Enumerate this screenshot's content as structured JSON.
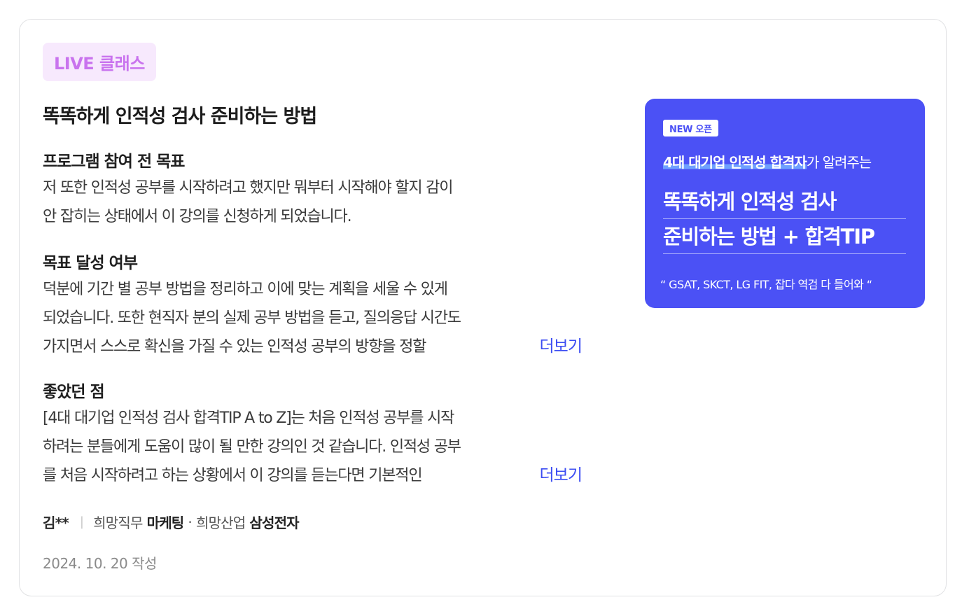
{
  "badge": "LIVE 클래스",
  "title": "똑똑하게 인적성 검사 준비하는 방법",
  "sections": [
    {
      "heading": "프로그램 참여 전 목표",
      "lines": [
        "저 또한 인적성 공부를 시작하려고 했지만 뭐부터 시작해야 할지 감이",
        "안 잡히는 상태에서 이 강의를 신청하게 되었습니다."
      ]
    },
    {
      "heading": "목표 달성 여부",
      "lines": [
        "덕분에 기간 별 공부 방법을 정리하고 이에 맞는 계획을 세울 수 있게",
        "되었습니다. 또한 현직자 분의 실제 공부 방법을 듣고, 질의응답 시간도",
        "가지면서 스스로 확신을 가질 수 있는 인적성 공부의 방향을 정할"
      ],
      "more": "더보기"
    },
    {
      "heading": "좋았던 점",
      "lines": [
        "[4대 대기업 인적성 검사 합격TIP A to Z]는 처음 인적성 공부를 시작",
        "하려는 분들에게 도움이 많이 될 만한 강의인 것 같습니다. 인적성 공부",
        "를 처음 시작하려고 하는 상황에서 이 강의를 듣는다면 기본적인"
      ],
      "more": "더보기"
    }
  ],
  "author": {
    "name": "김**",
    "job_label": "희망직무",
    "job_value": "마케팅",
    "industry_label": "희망산업",
    "industry_value": "삼성전자"
  },
  "date": "2024. 10. 20 작성",
  "banner": {
    "tag": "NEW 오픈",
    "sub_highlight": "4대 대기업 인적성 합격자",
    "sub_rest": "가 알려주는",
    "headline_1": "똑똑하게 인적성 검사",
    "headline_2": "준비하는 방법 + 합격TIP",
    "quote": "“ GSAT, SKCT, LG FIT, 잡다 역검 다 들어와 “",
    "color": "#4b51f5"
  }
}
